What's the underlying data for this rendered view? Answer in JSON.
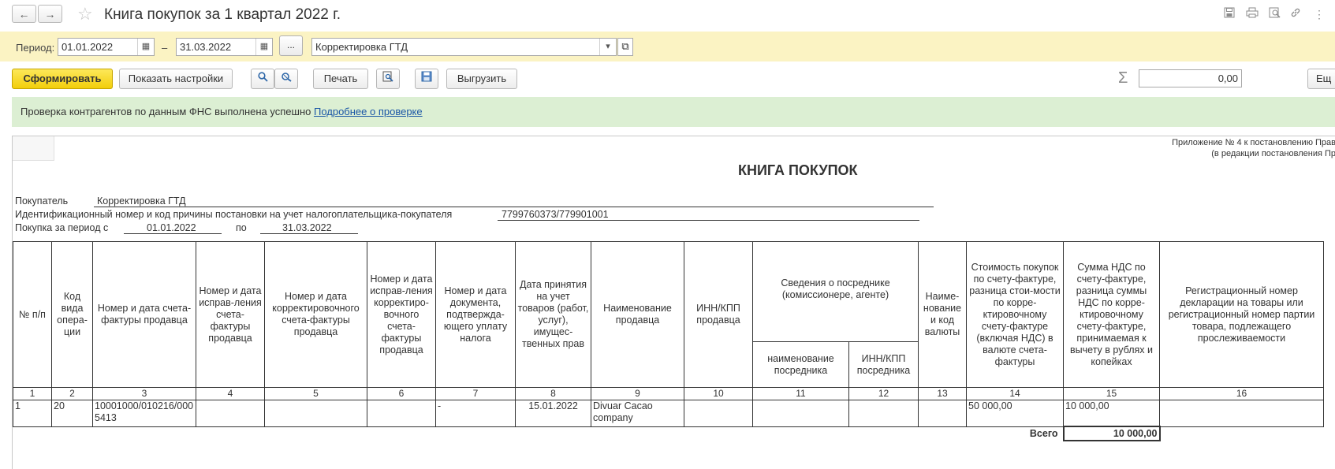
{
  "window": {
    "title": "Книга покупок за 1 квартал 2022 г.",
    "back_icon": "←",
    "forward_icon": "→",
    "favorite_icon": "☆",
    "title_icons": [
      "save-icon",
      "print-icon",
      "preview-icon",
      "link-icon",
      "more-icon"
    ]
  },
  "period": {
    "label": "Период:",
    "from": "01.01.2022",
    "dash": "–",
    "to": "31.03.2022",
    "dots_label": "...",
    "org": "Корректировка ГТД"
  },
  "toolbar": {
    "generate_label": "Сформировать",
    "settings_label": "Показать настройки",
    "print_label": "Печать",
    "export_label": "Выгрузить",
    "sum_symbol": "Σ",
    "sum_value": "0,00",
    "more_label": "Ещ"
  },
  "notice": {
    "text": "Проверка контрагентов по данным ФНС выполнена успешно ",
    "link": "Подробнее о проверке"
  },
  "report": {
    "appendix_line1": "Приложение № 4 к постановлению Прав",
    "appendix_line2": "(в редакции постановления Пр",
    "title": "КНИГА ПОКУПОК",
    "buyer_label": "Покупатель",
    "buyer_value": "Корректировка ГТД",
    "inn_label": "Идентификационный номер и код причины постановки на учет налогоплательщика-покупателя",
    "inn_value": "7799760373/779901001",
    "period_label": "Покупка за период с",
    "period_from": "01.01.2022",
    "period_to_label": "по",
    "period_to": "31.03.2022",
    "headers": {
      "h1": "№ п/п",
      "h2": "Код вида опера-ции",
      "h3": "Номер и дата счета-фактуры продавца",
      "h4": "Номер и дата исправ-ления счета-фактуры продавца",
      "h5": "Номер и дата корректировочного счета-фактуры продавца",
      "h6": "Номер и дата исправ-ления корректиро-вочного счета-фактуры продавца",
      "h7": "Номер и дата документа, подтвержда-ющего уплату налога",
      "h8": "Дата принятия на учет товаров (работ, услуг), имущес-твенных прав",
      "h9": "Наименование продавца",
      "h10": "ИНН/КПП продавца",
      "h11_group": "Сведения о посреднике (комиссионере, агенте)",
      "h11": "наименование посредника",
      "h12": "ИНН/КПП посредника",
      "h13": "Наиме-нование и код валюты",
      "h14": "Стоимость покупок по счету-фактуре, разница стои-мости по корре-ктировочному счету-фактуре (включая НДС) в валюте счета-фактуры",
      "h15": "Сумма НДС по счету-фактуре, разница суммы НДС по корре-ктировочному счету-фактуре, принимаемая к вычету в рублях и копейках",
      "h16": "Регистрационный номер декларации на товары или регистрационный номер партии товара, подлежащего прослеживаемости"
    },
    "column_numbers": [
      "1",
      "2",
      "3",
      "4",
      "5",
      "6",
      "7",
      "8",
      "9",
      "10",
      "11",
      "12",
      "13",
      "14",
      "15",
      "16"
    ],
    "row": {
      "n": "1",
      "code": "20",
      "invoice": "10001000/010216/0005413",
      "doc": "-",
      "date": "15.01.2022",
      "seller": "Divuar Cacao company",
      "cost": "50 000,00",
      "vat": "10 000,00"
    },
    "total_label": "Всего",
    "total_vat": "10 000,00"
  }
}
